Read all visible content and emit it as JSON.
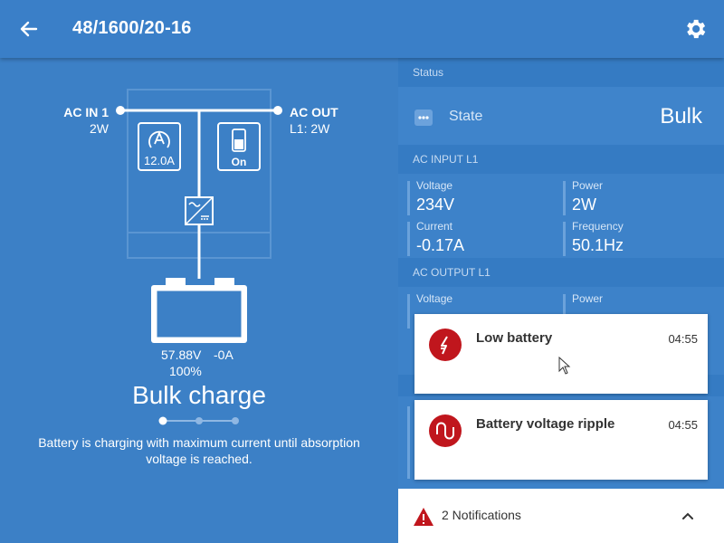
{
  "header": {
    "title": "48/1600/20-16"
  },
  "diagram": {
    "ac_in_label": "AC IN 1",
    "ac_in_value": "2W",
    "ac_out_label": "AC OUT",
    "ac_out_value": "L1: 2W",
    "current_limit_value": "12.0A",
    "switch_value": "On",
    "battery_voltage": "57.88V",
    "battery_current": "-0A",
    "battery_soc": "100%",
    "state_title": "Bulk charge",
    "description": "Battery is charging with maximum current until absorption voltage is reached."
  },
  "status": {
    "section_label": "Status",
    "state_label": "State",
    "state_value": "Bulk"
  },
  "ac_input": {
    "section_label": "AC INPUT L1",
    "voltage_label": "Voltage",
    "voltage_value": "234V",
    "power_label": "Power",
    "power_value": "2W",
    "current_label": "Current",
    "current_value": "-0.17A",
    "frequency_label": "Frequency",
    "frequency_value": "50.1Hz"
  },
  "ac_output": {
    "section_label": "AC OUTPUT L1",
    "voltage_label": "Voltage",
    "power_label": "Power"
  },
  "notifications": [
    {
      "title": "Low battery",
      "time": "04:55",
      "icon": "lightning-icon"
    },
    {
      "title": "Battery voltage ripple",
      "time": "04:55",
      "icon": "ripple-icon"
    }
  ],
  "notification_bar": {
    "label": "2 Notifications"
  },
  "colors": {
    "background": "#3d80c6",
    "header": "#3a7fc8",
    "alarm": "#c0161d",
    "card": "#ffffff"
  }
}
